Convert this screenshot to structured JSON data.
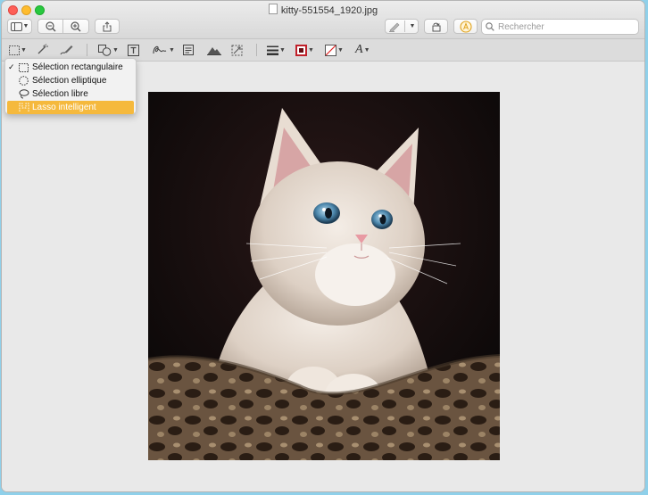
{
  "window": {
    "title": "kitty-551554_1920.jpg"
  },
  "toolbar": {
    "sidebar_button": "sidebar-toggle-icon",
    "zoom_out": "zoom-out-icon",
    "zoom_in": "zoom-in-icon",
    "share": "share-icon",
    "markup_pen": "pen-icon",
    "rotate": "rotate-icon",
    "annotate": "markup-icon",
    "search": {
      "placeholder": "Rechercher"
    }
  },
  "markup_toolbar": {
    "tools": [
      "rectangular-selection-icon",
      "instant-alpha-icon",
      "sketch-icon",
      "shapes-icon",
      "text-icon",
      "sign-icon",
      "note-icon",
      "adjust-color-icon",
      "adjust-size-icon",
      "line-style-icon",
      "border-color-icon",
      "fill-color-icon",
      "text-style-icon"
    ],
    "border_color": "#c0202a",
    "text_style_label": "A"
  },
  "selection_menu": {
    "items": [
      {
        "label": "Sélection rectangulaire",
        "checked": "✓",
        "icon": "dashed-rectangle-icon"
      },
      {
        "label": "Sélection elliptique",
        "icon": "dashed-ellipse-icon"
      },
      {
        "label": "Sélection libre",
        "icon": "lasso-icon"
      },
      {
        "label": "Lasso intelligent",
        "icon": "smart-lasso-icon",
        "highlighted": true
      }
    ]
  },
  "image": {
    "subject": "kitten-photo"
  },
  "colors": {
    "accent": "#f5b93d",
    "close": "#fe5f57",
    "minimize": "#febc2e",
    "maximize": "#28c840"
  }
}
